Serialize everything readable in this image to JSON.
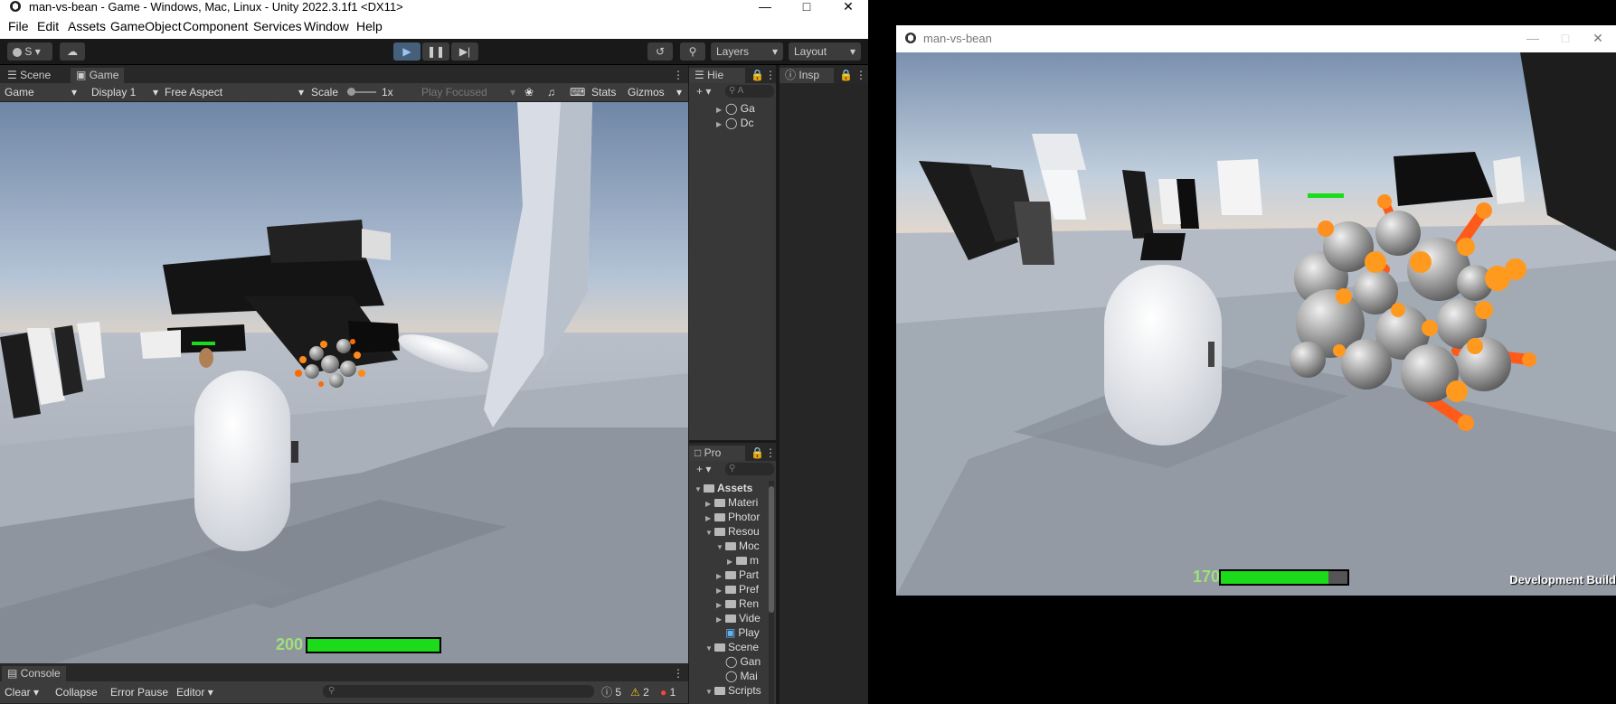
{
  "unity": {
    "title": "man-vs-bean - Game - Windows, Mac, Linux - Unity 2022.3.1f1 <DX11>",
    "menu": [
      "File",
      "Edit",
      "Assets",
      "GameObject",
      "Component",
      "Services",
      "Window",
      "Help"
    ],
    "account_label": "S",
    "layers_label": "Layers",
    "layout_label": "Layout",
    "tabs": {
      "scene": "Scene",
      "game": "Game"
    },
    "game_controls": {
      "view": "Game",
      "display": "Display 1",
      "aspect": "Free Aspect",
      "scale_label": "Scale",
      "scale_value": "1x",
      "play_focused": "Play Focused",
      "stats": "Stats",
      "gizmos": "Gizmos"
    },
    "hud": {
      "health_value": "200",
      "health_fraction": 1.0
    },
    "hierarchy": {
      "tab": "Hie",
      "search_placeholder": "A",
      "items": [
        "Ga",
        "Dc"
      ]
    },
    "inspector": {
      "tab": "Insp"
    },
    "project": {
      "tab": "Pro",
      "items": [
        {
          "label": "Assets",
          "indent": 0,
          "open": true,
          "bold": true
        },
        {
          "label": "Materi",
          "indent": 1,
          "open": false
        },
        {
          "label": "Photor",
          "indent": 1,
          "open": false
        },
        {
          "label": "Resou",
          "indent": 1,
          "open": true
        },
        {
          "label": "Moc",
          "indent": 2,
          "open": true
        },
        {
          "label": "m",
          "indent": 3,
          "open": false
        },
        {
          "label": "Part",
          "indent": 2,
          "open": false
        },
        {
          "label": "Pref",
          "indent": 2,
          "open": false
        },
        {
          "label": "Ren",
          "indent": 2,
          "open": false
        },
        {
          "label": "Vide",
          "indent": 2,
          "open": false
        },
        {
          "label": "Play",
          "indent": 2,
          "open": false,
          "prefab": true
        },
        {
          "label": "Scene",
          "indent": 1,
          "open": true
        },
        {
          "label": "Gan",
          "indent": 2,
          "scene": true
        },
        {
          "label": "Mai",
          "indent": 2,
          "scene": true
        },
        {
          "label": "Scripts",
          "indent": 1,
          "open": true
        }
      ]
    },
    "console": {
      "tab": "Console",
      "clear": "Clear",
      "collapse": "Collapse",
      "error_pause": "Error Pause",
      "editor": "Editor",
      "log_count": "5",
      "warn_count": "2",
      "error_count": "1"
    }
  },
  "player": {
    "title": "man-vs-bean",
    "health_value": "170",
    "health_fraction": 0.85,
    "dev_build": "Development Build"
  }
}
